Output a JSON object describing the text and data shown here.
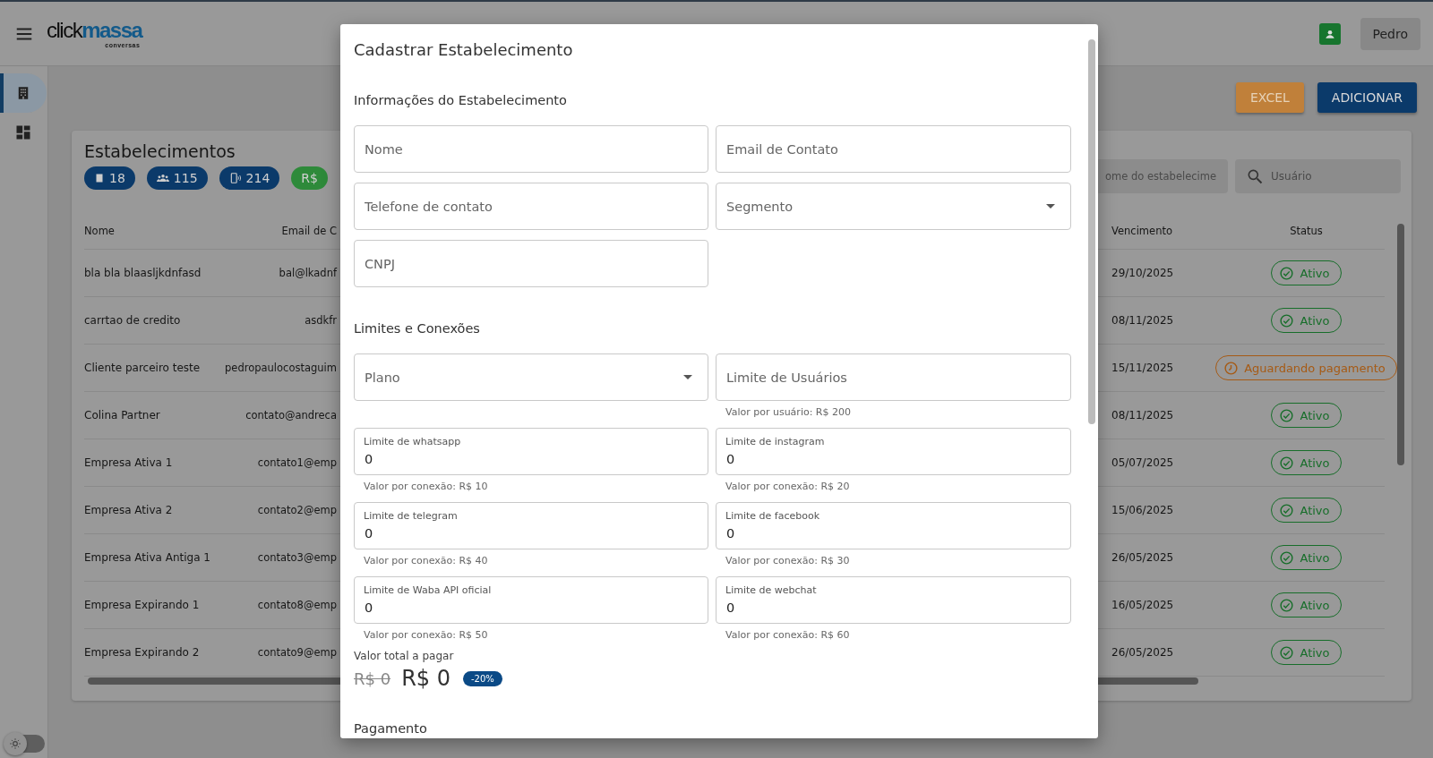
{
  "header": {
    "logo": {
      "part_a": "click",
      "part_b": "massa",
      "sub": "conversas"
    },
    "user": "Pedro"
  },
  "sidebar": {
    "items": [
      {
        "kind": "building",
        "selected": true
      },
      {
        "kind": "dashboard",
        "selected": false
      }
    ],
    "theme_toggle": {
      "on": false
    }
  },
  "actions": [
    {
      "kind": "export",
      "label": "EXCEL"
    },
    {
      "kind": "primary",
      "label": "ADICIONAR"
    }
  ],
  "card": {
    "title": "Estabelecimentos",
    "badges": [
      {
        "kind": "building",
        "text": "18",
        "color": "#0b3a6a"
      },
      {
        "kind": "users",
        "text": "115",
        "color": "#0b3a6a"
      },
      {
        "kind": "phone",
        "text": "214",
        "color": "#0b3a6a"
      },
      {
        "kind": "money",
        "text": "R$",
        "color": "#2e8a3a"
      }
    ],
    "filters": [
      {
        "kind": "text",
        "placeholder": "ome do estabelecime"
      },
      {
        "kind": "search",
        "placeholder": "Usuário"
      }
    ],
    "table": {
      "columns": [
        "Nome",
        "Email de C",
        "Vencimento",
        "Status"
      ],
      "rows": [
        {
          "name": "bla bla blaasljkdnfasd",
          "email": "bal@lkadnf",
          "due": "29/10/2025",
          "status": {
            "kind": "active",
            "text": "Ativo"
          }
        },
        {
          "name": "carrtao de credito",
          "email": "asdkfr",
          "due": "08/11/2025",
          "status": {
            "kind": "active",
            "text": "Ativo"
          }
        },
        {
          "name": "Cliente parceiro teste",
          "email": "pedropaulocostaguim",
          "due": "15/11/2025",
          "status": {
            "kind": "pending",
            "text": "Aguardando pagamento"
          }
        },
        {
          "name": "Colina Partner",
          "email": "contato@andreca",
          "due": "08/11/2025",
          "status": {
            "kind": "active",
            "text": "Ativo"
          }
        },
        {
          "name": "Empresa Ativa 1",
          "email": "contato1@emp",
          "due": "05/07/2025",
          "status": {
            "kind": "active",
            "text": "Ativo"
          }
        },
        {
          "name": "Empresa Ativa 2",
          "email": "contato2@emp",
          "due": "15/06/2025",
          "status": {
            "kind": "active",
            "text": "Ativo"
          }
        },
        {
          "name": "Empresa Ativa Antiga 1",
          "email": "contato3@emp",
          "due": "26/05/2025",
          "status": {
            "kind": "active",
            "text": "Ativo"
          }
        },
        {
          "name": "Empresa Expirando 1",
          "email": "contato8@emp",
          "due": "16/05/2025",
          "status": {
            "kind": "active",
            "text": "Ativo"
          }
        },
        {
          "name": "Empresa Expirando 2",
          "email": "contato9@emp",
          "due": "26/05/2025",
          "status": {
            "kind": "active",
            "text": "Ativo"
          }
        }
      ]
    }
  },
  "dialog": {
    "title": "Cadastrar Estabelecimento",
    "sections": [
      {
        "title": "Informações do Estabelecimento",
        "fields": [
          {
            "kind": "text",
            "placeholder": "Nome"
          },
          {
            "kind": "text",
            "placeholder": "Email de Contato"
          },
          {
            "kind": "text",
            "placeholder": "Telefone de contato"
          },
          {
            "kind": "select",
            "placeholder": "Segmento"
          },
          {
            "kind": "text",
            "placeholder": "CNPJ"
          }
        ]
      },
      {
        "title": "Limites e Conexões",
        "fields": [
          {
            "kind": "select",
            "placeholder": "Plano"
          },
          {
            "kind": "text",
            "placeholder": "Limite de Usuários",
            "hint": "Valor por usuário: R$ 200"
          },
          {
            "kind": "text",
            "label": "Limite de whatsapp",
            "value": "0",
            "hint": "Valor por conexão: R$ 10"
          },
          {
            "kind": "text",
            "label": "Limite de instagram",
            "value": "0",
            "hint": "Valor por conexão: R$ 20"
          },
          {
            "kind": "text",
            "label": "Limite de telegram",
            "value": "0",
            "hint": "Valor por conexão: R$ 40"
          },
          {
            "kind": "text",
            "label": "Limite de facebook",
            "value": "0",
            "hint": "Valor por conexão: R$ 30"
          },
          {
            "kind": "text",
            "label": "Limite de Waba API oficial",
            "value": "0",
            "hint": "Valor por conexão: R$ 50"
          },
          {
            "kind": "text",
            "label": "Limite de webchat",
            "value": "0",
            "hint": "Valor por conexão: R$ 60"
          }
        ]
      }
    ],
    "total": {
      "label": "Valor total a pagar",
      "old": "R$ 0",
      "new": "R$ 0",
      "discount": "-20%"
    },
    "next_section": "Pagamento"
  }
}
